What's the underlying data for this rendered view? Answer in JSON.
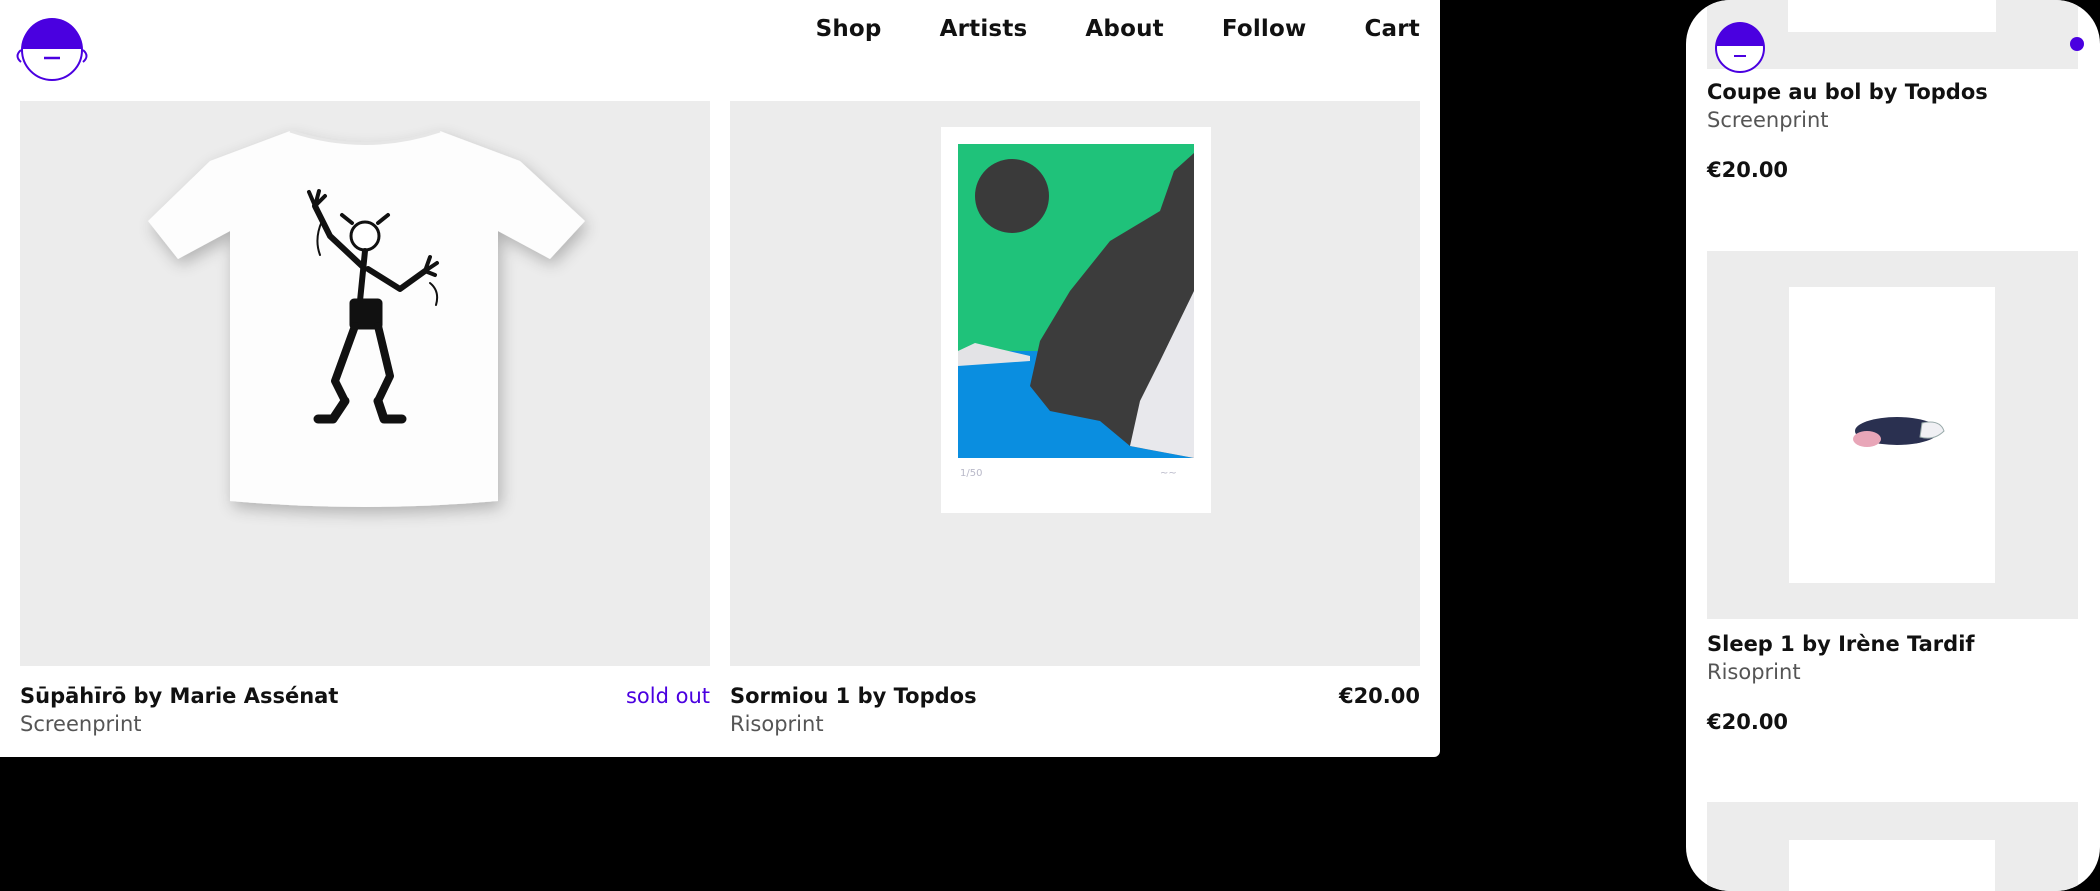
{
  "nav": {
    "items": [
      "Shop",
      "Artists",
      "About",
      "Follow",
      "Cart"
    ]
  },
  "colors": {
    "accent": "#4a00e0",
    "tile_bg": "#ececec",
    "page_bg": "#000000"
  },
  "products": [
    {
      "title": "Sūpāhīrō by Marie Assénat",
      "type": "Screenprint",
      "status": "sold out"
    },
    {
      "title": "Sormiou 1 by Topdos",
      "type": "Risoprint",
      "price": "€20.00"
    }
  ],
  "mobile": {
    "products": [
      {
        "title": "Coupe au bol by Topdos",
        "type": "Screenprint",
        "price": "€20.00"
      },
      {
        "title": "Sleep 1 by Irène Tardif",
        "type": "Risoprint",
        "price": "€20.00"
      }
    ]
  },
  "icons": [
    "logo-face-icon",
    "menu-dot-icon"
  ]
}
